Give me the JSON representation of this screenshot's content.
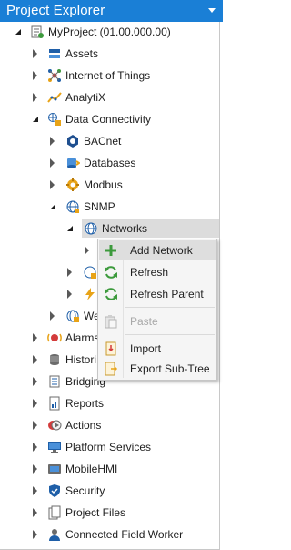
{
  "header": {
    "title": "Project Explorer"
  },
  "tree": {
    "project": "MyProject (01.00.000.00)",
    "assets": "Assets",
    "iot": "Internet of Things",
    "analytix": "AnalytiX",
    "data_connectivity": "Data Connectivity",
    "bacnet": "BACnet",
    "databases": "Databases",
    "modbus": "Modbus",
    "snmp": "SNMP",
    "networks": "Networks",
    "web_partial": "We",
    "alarms_partial": "Alarms",
    "historian_partial": "Histori",
    "bridging": "Bridging",
    "reports": "Reports",
    "actions": "Actions",
    "platform_services": "Platform Services",
    "mobilehmi": "MobileHMI",
    "security": "Security",
    "project_files": "Project Files",
    "connected_field_worker": "Connected Field Worker"
  },
  "context_menu": {
    "add_network": "Add Network",
    "refresh": "Refresh",
    "refresh_parent": "Refresh Parent",
    "paste": "Paste",
    "import": "Import",
    "export_subtree": "Export Sub-Tree"
  },
  "colors": {
    "header_bg": "#1a7fd6",
    "selection": "#dcdcdc",
    "menu_highlight": "#dedede",
    "icon_blue": "#1f5fa8",
    "icon_green": "#3c9a3c",
    "icon_orange": "#e8a317",
    "icon_red": "#d33b3b"
  }
}
